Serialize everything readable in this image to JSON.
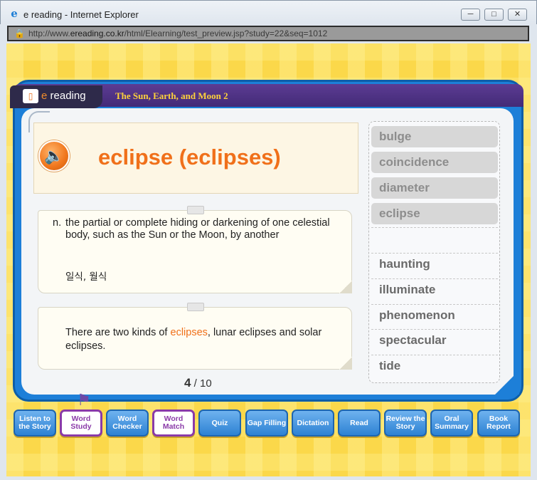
{
  "window": {
    "title": "e reading - Internet Explorer",
    "url_prefix": "http://www.",
    "url_domain": "ereading.co.kr",
    "url_suffix": "/html/Elearning/test_preview.jsp?study=22&seq=1012"
  },
  "header": {
    "logo_e": "e",
    "logo_text": "reading",
    "story_title": "The Sun, Earth, and Moon 2"
  },
  "word": {
    "title": "eclipse (eclipses)",
    "pos": "n.",
    "definition": "the partial or complete hiding or darkening of one celestial body, such as the Sun or the Moon, by another",
    "korean": "일식, 월식",
    "example_before": "There are two kinds of ",
    "example_highlight": "eclipses",
    "example_after": ", lunar eclipses and solar eclipses."
  },
  "pager": {
    "current": "4",
    "total": "/ 10"
  },
  "word_list": {
    "used": [
      "bulge",
      "coincidence",
      "diameter",
      "eclipse"
    ],
    "remaining": [
      "haunting",
      "illuminate",
      "phenomenon",
      "spectacular",
      "tide"
    ]
  },
  "nav": [
    {
      "label": "Listen to the Story",
      "active": false
    },
    {
      "label": "Word Study",
      "active": true
    },
    {
      "label": "Word Checker",
      "active": false
    },
    {
      "label": "Word Match",
      "active": true
    },
    {
      "label": "Quiz",
      "active": false
    },
    {
      "label": "Gap Filling",
      "active": false
    },
    {
      "label": "Dictation",
      "active": false
    },
    {
      "label": "Read",
      "active": false
    },
    {
      "label": "Review the Story",
      "active": false
    },
    {
      "label": "Oral Summary",
      "active": false
    },
    {
      "label": "Book Report",
      "active": false
    }
  ],
  "icons": {
    "browser": "ie-icon",
    "lock": "lock-icon",
    "speaker": "speaker-icon",
    "flag": "flag-icon"
  },
  "colors": {
    "accent_orange": "#f0701a",
    "frame_blue": "#1d7fd8",
    "header_purple": "#4b3080",
    "background_yellow": "#fbd84a"
  }
}
